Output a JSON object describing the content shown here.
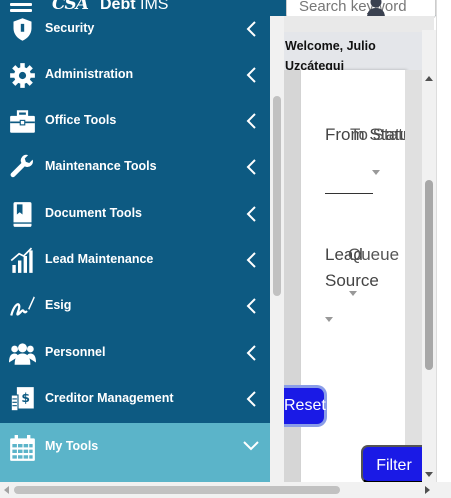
{
  "header": {
    "logo_mark": "CSA",
    "app_name_bold": "Debt",
    "app_name_rest": " IMS",
    "search_placeholder": "Search keyword",
    "menu_icon": "hamburger-icon",
    "user_icon": "user-icon"
  },
  "sidebar": {
    "items": [
      {
        "label": "Security",
        "icon": "shield-icon"
      },
      {
        "label": "Administration",
        "icon": "gear-icon"
      },
      {
        "label": "Office Tools",
        "icon": "briefcase-icon"
      },
      {
        "label": "Maintenance Tools",
        "icon": "wrench-icon"
      },
      {
        "label": "Document Tools",
        "icon": "book-icon"
      },
      {
        "label": "Lead Maintenance",
        "icon": "bar-chart-icon"
      },
      {
        "label": "Esig",
        "icon": "signature-icon"
      },
      {
        "label": "Personnel",
        "icon": "group-icon"
      },
      {
        "label": "Creditor Management",
        "icon": "money-document-icon"
      },
      {
        "label": "My Tools",
        "icon": "calendar-icon",
        "expanded": true
      }
    ]
  },
  "main": {
    "welcome_line1": "Welcome, Julio",
    "welcome_line2": "Uzcátegui",
    "from_status_label": "From Status",
    "to_status_label": "To Status",
    "lead_source_label_1": "Lead",
    "lead_source_label_2": "Source",
    "queue_label": "Queue",
    "reset_label": "Reset",
    "filter_label": "Filter"
  },
  "colors": {
    "sidebar_bg": "#0d5a82",
    "active_item_bg": "#5bb4c9",
    "button_bg": "#1a1ae6"
  }
}
